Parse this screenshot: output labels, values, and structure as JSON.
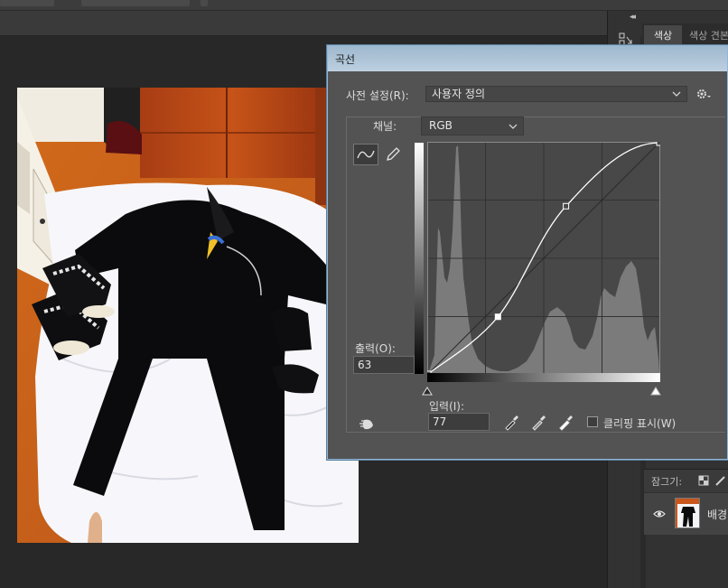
{
  "app": {
    "panel_tabs": {
      "color": "색상",
      "swatches": "색상 견본"
    },
    "layers": {
      "lock_label": "잠그기:",
      "layer_name": "배경"
    }
  },
  "curves_dialog": {
    "title": "곡선",
    "preset_label": "사전 설정(R):",
    "preset_value": "사용자 정의",
    "channel_label": "채널:",
    "channel_value": "RGB",
    "output_label": "출력(O):",
    "output_value": "63",
    "input_label": "입력(I):",
    "input_value": "77",
    "clipping_label": "클리핑 표시(W)",
    "clipping_checked": false,
    "curve_points_input_output": [
      [
        0,
        0
      ],
      [
        77,
        63
      ],
      [
        152,
        185
      ],
      [
        255,
        255
      ]
    ]
  },
  "colors": {
    "dialog_bg": "#535353",
    "titlebar": "#b4c9da",
    "histogram": "#7b7b7b",
    "curve": "#ffffff"
  },
  "icons": [
    "curve-tool-icon",
    "pencil-icon",
    "gear-icon",
    "auto-icon",
    "eyedropper-black-icon",
    "eyedropper-gray-icon",
    "eyedropper-white-icon",
    "eye-icon",
    "chevron-down-icon"
  ]
}
